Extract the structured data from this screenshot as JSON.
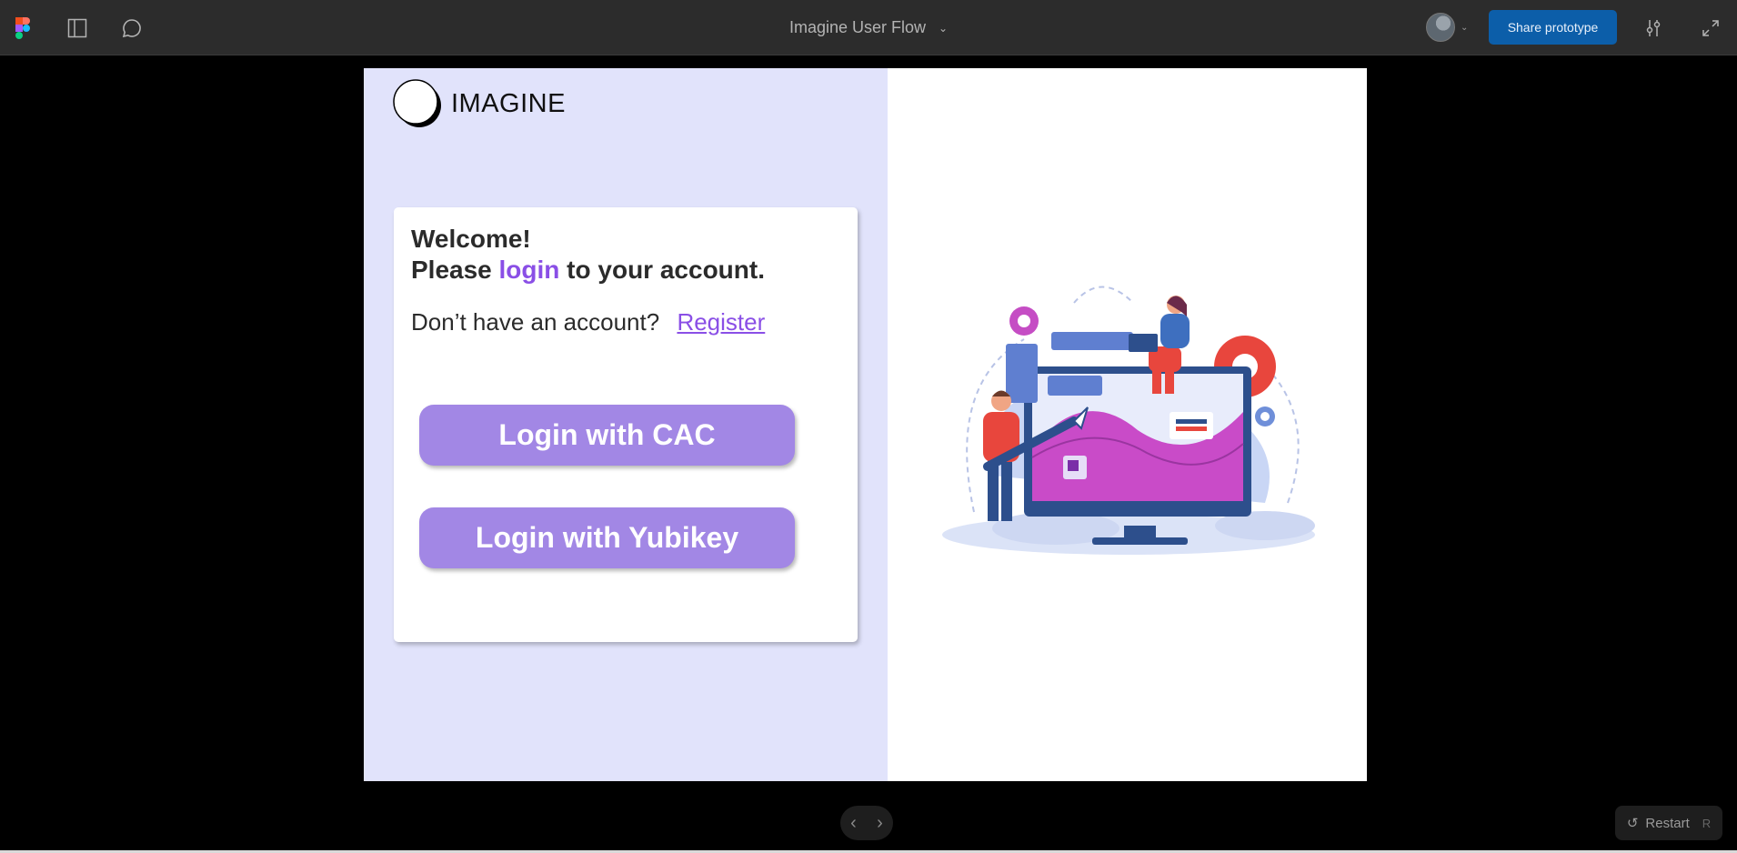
{
  "toolbar": {
    "title": "Imagine User Flow",
    "share_label": "Share prototype",
    "icons": [
      "figma-logo-icon",
      "sidebar-panel-icon",
      "comment-icon",
      "settings-sliders-icon",
      "expand-icon"
    ]
  },
  "prototype": {
    "logo_text": "IMAGINE",
    "welcome": "Welcome!",
    "login_line": {
      "before": "Please ",
      "highlight": "login",
      "after": " to your account."
    },
    "register_prompt": "Don’t have an account?",
    "register_link": "Register",
    "buttons": {
      "cac": "Login with CAC",
      "yubikey": "Login with Yubikey"
    },
    "colors": {
      "left_pane": "#e1e3fb",
      "accent": "#8a4fe6",
      "button": "#a287e5",
      "share_button": "#0c5ea9"
    }
  },
  "footer": {
    "restart_label": "Restart",
    "restart_shortcut": "R"
  }
}
